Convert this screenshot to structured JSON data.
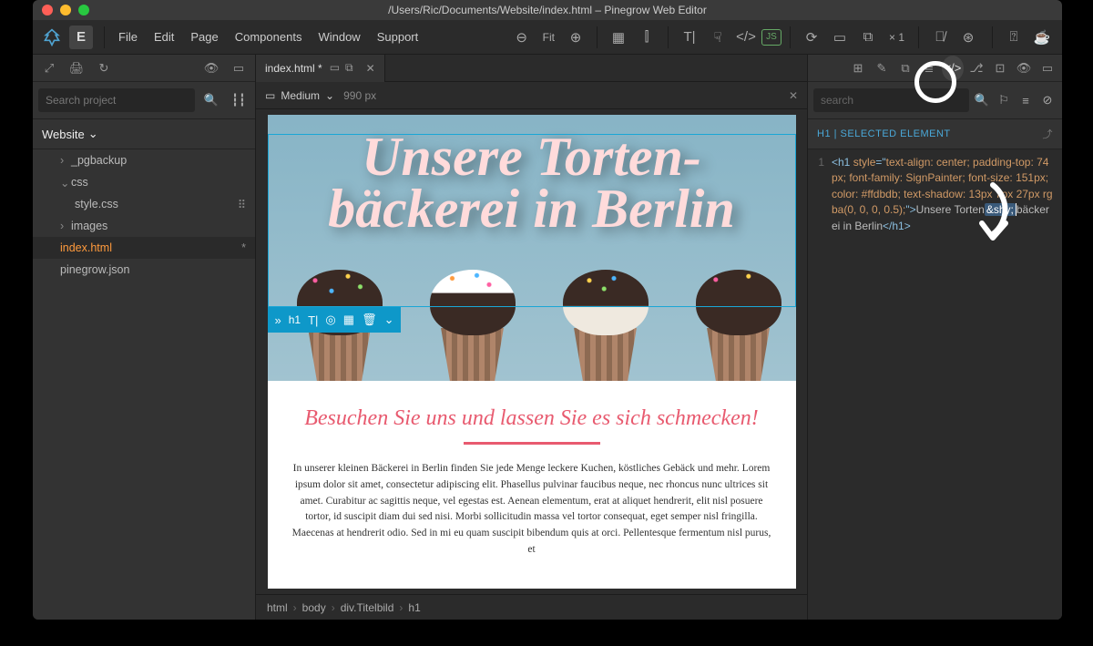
{
  "window": {
    "title": "/Users/Ric/Documents/Website/index.html – Pinegrow Web Editor"
  },
  "menu": {
    "items": [
      "File",
      "Edit",
      "Page",
      "Components",
      "Window",
      "Support"
    ],
    "fit": "Fit",
    "zoom": "× 1"
  },
  "left": {
    "search_placeholder": "Search project",
    "project_label": "Website",
    "tree": {
      "pgbackup": "_pgbackup",
      "css": "css",
      "stylecss": "style.css",
      "images": "images",
      "index": "index.html",
      "pinegrow": "pinegrow.json"
    }
  },
  "tab": {
    "label": "index.html *"
  },
  "viewport": {
    "device": "Medium",
    "size": "990 px"
  },
  "hero": {
    "h1": "Unsere Torten-\nbäckerei in Berlin"
  },
  "toolbar": {
    "expand": "»",
    "tag": "h1"
  },
  "content": {
    "subtitle": "Besuchen Sie uns und lassen Sie es sich schmecken!",
    "body": "In unserer kleinen Bäckerei in Berlin finden Sie jede Menge leckere Kuchen, köstliches Gebäck und mehr.  Lorem ipsum dolor sit amet, consectetur adipiscing elit. Phasellus pulvinar faucibus neque, nec rhoncus nunc ultrices sit amet. Curabitur ac sagittis neque, vel egestas est. Aenean elementum, erat at aliquet hendrerit, elit nisl posuere tortor, id suscipit diam dui sed nisi. Morbi sollicitudin massa vel tortor consequat, eget semper nisl fringilla. Maecenas at hendrerit odio. Sed in mi eu quam suscipit bibendum quis at orci. Pellentesque fermentum nisl purus, et"
  },
  "crumbs": [
    "html",
    "body",
    "div.Titelbild",
    "h1"
  ],
  "right": {
    "search_placeholder": "search",
    "panel_title": "H1 | SELECTED ELEMENT",
    "code": {
      "line": "1",
      "open_tag": "<h1",
      "style_attr": "style",
      "style_val": "text-align: center; padding-top: 74px; font-family: SignPainter; font-size: 151px; color: #ffdbdb; text-shadow: 13px 7px 27px rgba(0, 0, 0, 0.5);",
      "text_before": "Unsere Torten",
      "shy": "&shy;",
      "text_after": "bäckerei in Berlin",
      "close_tag": "</h1>"
    }
  }
}
